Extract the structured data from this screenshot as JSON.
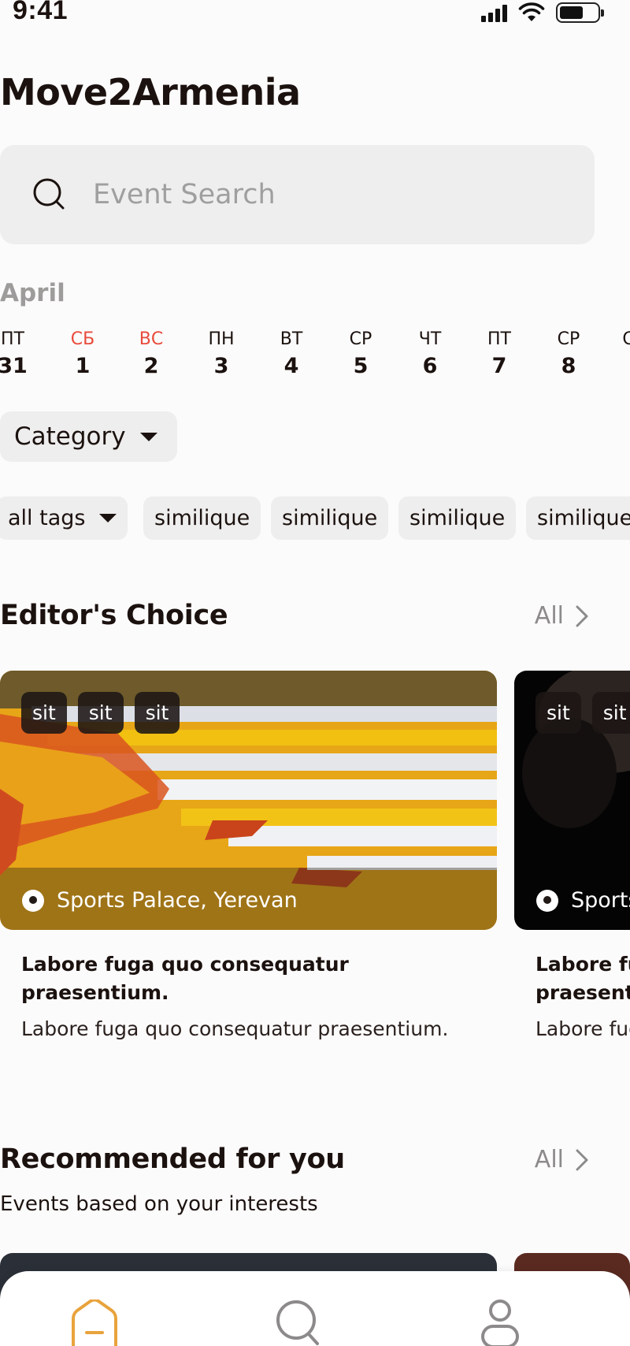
{
  "status_bar": {
    "time": "9:41"
  },
  "app": {
    "title": "Move2Armenia"
  },
  "search": {
    "placeholder": "Event Search"
  },
  "calendar": {
    "month": "April",
    "days": [
      {
        "dow": "ПТ",
        "num": "31",
        "weekend": false
      },
      {
        "dow": "СБ",
        "num": "1",
        "weekend": true
      },
      {
        "dow": "ВС",
        "num": "2",
        "weekend": true
      },
      {
        "dow": "ПН",
        "num": "3",
        "weekend": false
      },
      {
        "dow": "ВТ",
        "num": "4",
        "weekend": false
      },
      {
        "dow": "СР",
        "num": "5",
        "weekend": false
      },
      {
        "dow": "ЧТ",
        "num": "6",
        "weekend": false
      },
      {
        "dow": "ПТ",
        "num": "7",
        "weekend": false
      },
      {
        "dow": "СР",
        "num": "8",
        "weekend": false
      }
    ]
  },
  "filters": {
    "category_label": "Category",
    "all_tags_label": "all tags",
    "tags": [
      "similique",
      "similique",
      "similique",
      "similique"
    ]
  },
  "editors_choice": {
    "title": "Editor's Choice",
    "all_label": "All",
    "cards": [
      {
        "badges": [
          "sit",
          "sit",
          "sit"
        ],
        "location": "Sports Palace, Yerevan",
        "title": "Labore fuga quo consequatur praesentium.",
        "description": "Labore fuga quo consequatur praesentium."
      },
      {
        "badges": [
          "sit",
          "sit"
        ],
        "location": "Sports Palace, Yerevan",
        "title": "Labore fuga quo consequatur praesentium.",
        "description": "Labore fuga quo consequatur praesentium."
      }
    ]
  },
  "recommended": {
    "title": "Recommended for you",
    "all_label": "All",
    "subtitle": "Events based on your interests"
  },
  "colors": {
    "accent": "#e8a33c",
    "weekend": "#e84b3c",
    "chip_bg": "#efeeee"
  },
  "bottom_nav": [
    {
      "icon": "home-icon",
      "active": true
    },
    {
      "icon": "search-icon",
      "active": false
    },
    {
      "icon": "profile-icon",
      "active": false
    }
  ]
}
